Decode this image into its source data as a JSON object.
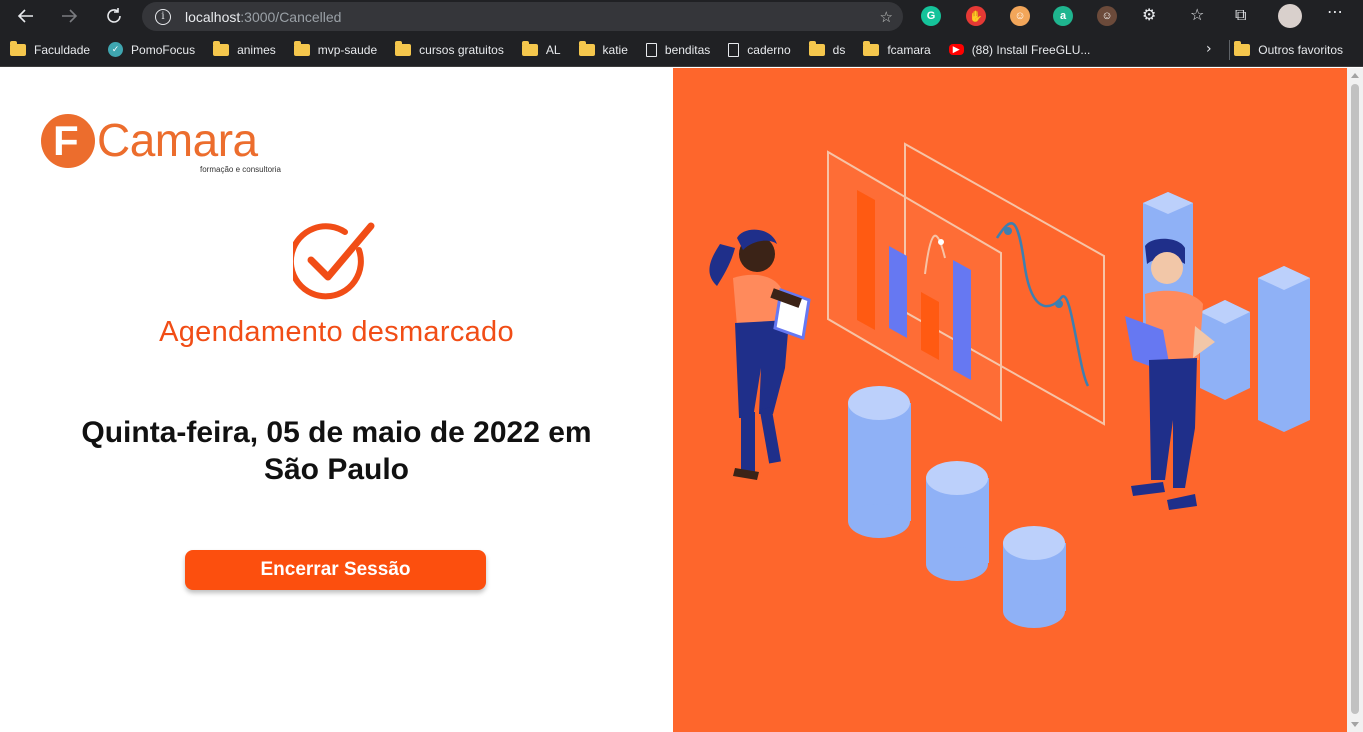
{
  "browser": {
    "url_host": "localhost",
    "url_path": ":3000/Cancelled",
    "bookmarks": [
      "Faculdade",
      "PomoFocus",
      "animes",
      "mvp-saude",
      "cursos gratuitos",
      "AL",
      "katie",
      "benditas",
      "caderno",
      "ds",
      "fcamara",
      "(88) Install FreeGLU..."
    ],
    "other_bookmarks": "Outros favoritos"
  },
  "logo": {
    "letter": "F",
    "name": "Camara",
    "tagline": "formação e consultoria"
  },
  "status": {
    "title": "Agendamento desmarcado"
  },
  "appointment": {
    "date_line_1": "Quinta-feira, 05 de maio de 2022 em",
    "date_line_2": "São Paulo"
  },
  "actions": {
    "end_session": "Encerrar Sessão"
  },
  "colors": {
    "brand_orange": "#ec6d2d",
    "accent": "#fc4f0e",
    "hero_bg": "#fe662c"
  }
}
